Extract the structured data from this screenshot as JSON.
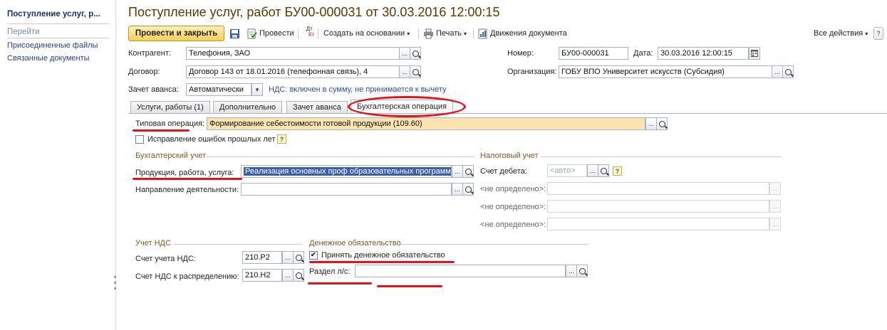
{
  "sidebar": {
    "title": "Поступление услуг, р...",
    "goto_label": "Перейти",
    "links": [
      "Присоединенные файлы",
      "Связанные документы"
    ]
  },
  "window": {
    "title": "Поступление услуг, работ БУ00-000031 от 30.03.2016 12:00:15"
  },
  "toolbar": {
    "post_close": "Провести и закрыть",
    "post": "Провести",
    "create_based": "Создать на основании",
    "print": "Печать",
    "movements": "Движения документа",
    "all_actions": "Все действия",
    "dt_kt_top": "Дт",
    "dt_kt_bottom": "Кт"
  },
  "header": {
    "contractor_label": "Контрагент:",
    "contractor_value": "Телефония, ЗАО",
    "contract_label": "Договор:",
    "contract_value": "Договор 143 от 18.01.2016 (телефонная связь), 4",
    "advance_label": "Зачет аванса:",
    "advance_value": "Автоматически",
    "vat_link": "НДС: включен в сумму, не принимается к вычету",
    "number_label": "Номер:",
    "number_value": "БУ00-000031",
    "date_label": "Дата:",
    "date_value": "30.03.2016 12:00:15",
    "org_label": "Организация:",
    "org_value": "ГОБУ ВПО Университет искусств (Субсидия)"
  },
  "tabs": [
    "Услуги, работы (1)",
    "Дополнительно",
    "Зачет аванса",
    "Бухгалтерская операция"
  ],
  "operation": {
    "label": "Типовая операция:",
    "value": "Формирование себестоимости готовой продукции (109.60)",
    "fix_errors": "Исправление ошибок прошлых лет",
    "help": "?"
  },
  "accounting": {
    "title": "Бухгалтерский учет",
    "product_label": "Продукция, работа, услуга:",
    "product_value": "Реализация основных проф образовательных программ",
    "direction_label": "Направление деятельности:"
  },
  "tax": {
    "title": "Налоговый учет",
    "debit_label": "Счет дебета:",
    "debit_placeholder": "<авто>",
    "undefined_labels": [
      "<не определено>:",
      "<не определено>:",
      "<не определено>:",
      "<не определено>:"
    ]
  },
  "vat": {
    "title": "Учет НДС",
    "account_label": "Счет учета НДС:",
    "account_value": "210.Р2",
    "distribution_label": "Счет НДС к распределению:",
    "distribution_value": "210.Н2"
  },
  "obligation": {
    "title": "Денежное обязательство",
    "accept_label": "Принять денежное обязательство",
    "section_label": "Раздел л/с:",
    "checked_mark": "✔"
  },
  "button_glyphs": {
    "dots": "...",
    "down": "▾"
  }
}
